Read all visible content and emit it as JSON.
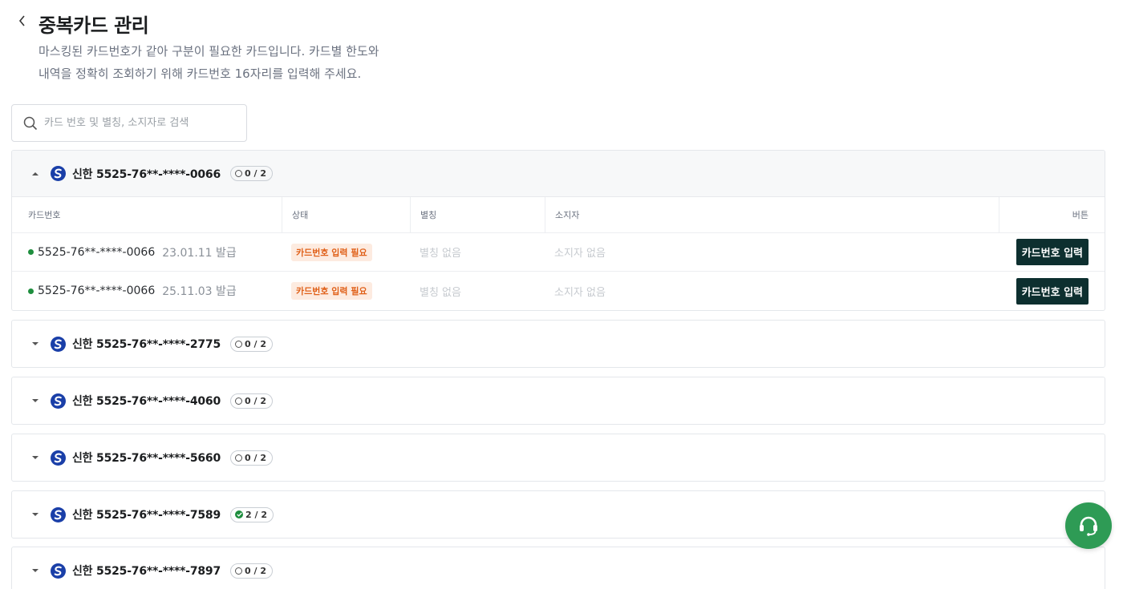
{
  "page": {
    "title": "중복카드 관리",
    "description_line1": "마스킹된 카드번호가 같아 구분이 필요한 카드입니다. 카드별 한도와",
    "description_line2": "내역을 정확히 조회하기 위해 카드번호 16자리를 입력해 주세요."
  },
  "search": {
    "placeholder": "카드 번호 및 별칭, 소지자로 검색",
    "value": ""
  },
  "table_headers": {
    "card_number": "카드번호",
    "status": "상태",
    "alias": "별칭",
    "holder": "소지자",
    "button": "버튼"
  },
  "groups": [
    {
      "title": "신한 5525-76**-****-0066",
      "count": "0 / 2",
      "expanded": true,
      "completed": false,
      "rows": [
        {
          "card_number": "5525-76**-****-0066",
          "issued": "23.01.11 발급",
          "status": "카드번호 입력 필요",
          "alias": "별칭 없음",
          "holder": "소지자 없음",
          "button": "카드번호 입력"
        },
        {
          "card_number": "5525-76**-****-0066",
          "issued": "25.11.03 발급",
          "status": "카드번호 입력 필요",
          "alias": "별칭 없음",
          "holder": "소지자 없음",
          "button": "카드번호 입력"
        }
      ]
    },
    {
      "title": "신한 5525-76**-****-2775",
      "count": "0 / 2",
      "expanded": false,
      "completed": false
    },
    {
      "title": "신한 5525-76**-****-4060",
      "count": "0 / 2",
      "expanded": false,
      "completed": false
    },
    {
      "title": "신한 5525-76**-****-5660",
      "count": "0 / 2",
      "expanded": false,
      "completed": false
    },
    {
      "title": "신한 5525-76**-****-7589",
      "count": "2 / 2",
      "expanded": false,
      "completed": true
    },
    {
      "title": "신한 5525-76**-****-7897",
      "count": "0 / 2",
      "expanded": false,
      "completed": false
    }
  ],
  "colors": {
    "brand_logo": "#1a3fa8",
    "status_badge_bg": "#fdebe0",
    "status_badge_text": "#e0611a",
    "primary_button": "#0d2f2f",
    "chat_button": "#2e9b55",
    "active_dot": "#1e8e3e"
  },
  "icons": {
    "back": "chevron-left-icon",
    "search": "search-icon",
    "bank": "shinhan-logo-icon",
    "chat": "headset-icon"
  }
}
